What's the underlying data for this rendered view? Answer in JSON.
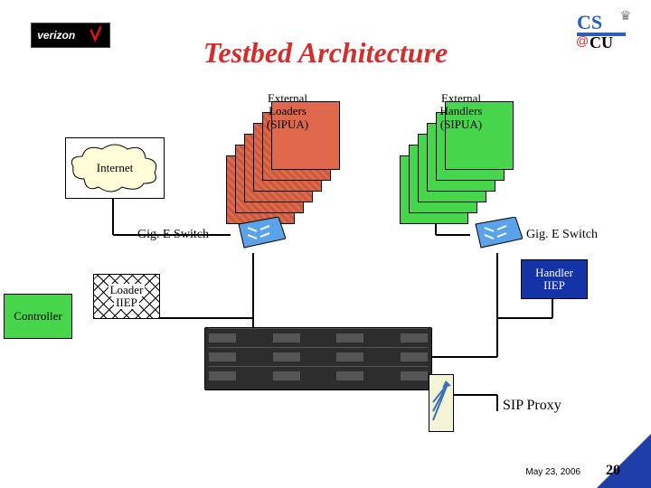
{
  "title": "Testbed Architecture",
  "logos": {
    "verizon_alt": "verizon",
    "cscu_cs": "CS",
    "cscu_cu": "CU",
    "cscu_at": "@"
  },
  "cloud": {
    "label": "Internet"
  },
  "stacks": {
    "loaders": {
      "line1": "External",
      "line2": "Loaders",
      "line3": "(SIPUA)"
    },
    "handlers": {
      "line1": "External",
      "line2": "Handlers",
      "line3": "(SIPUA)"
    }
  },
  "switches": {
    "left_label": "Gig. E Switch",
    "right_label": "Gig. E Switch"
  },
  "boxes": {
    "controller": "Controller",
    "loader_iiep_l1": "Loader",
    "loader_iiep_l2": "IIEP",
    "handler_iiep_l1": "Handler",
    "handler_iiep_l2": "IIEP"
  },
  "proxy_label": "SIP Proxy",
  "footer": {
    "date": "May 23, 2006",
    "page": "20"
  }
}
